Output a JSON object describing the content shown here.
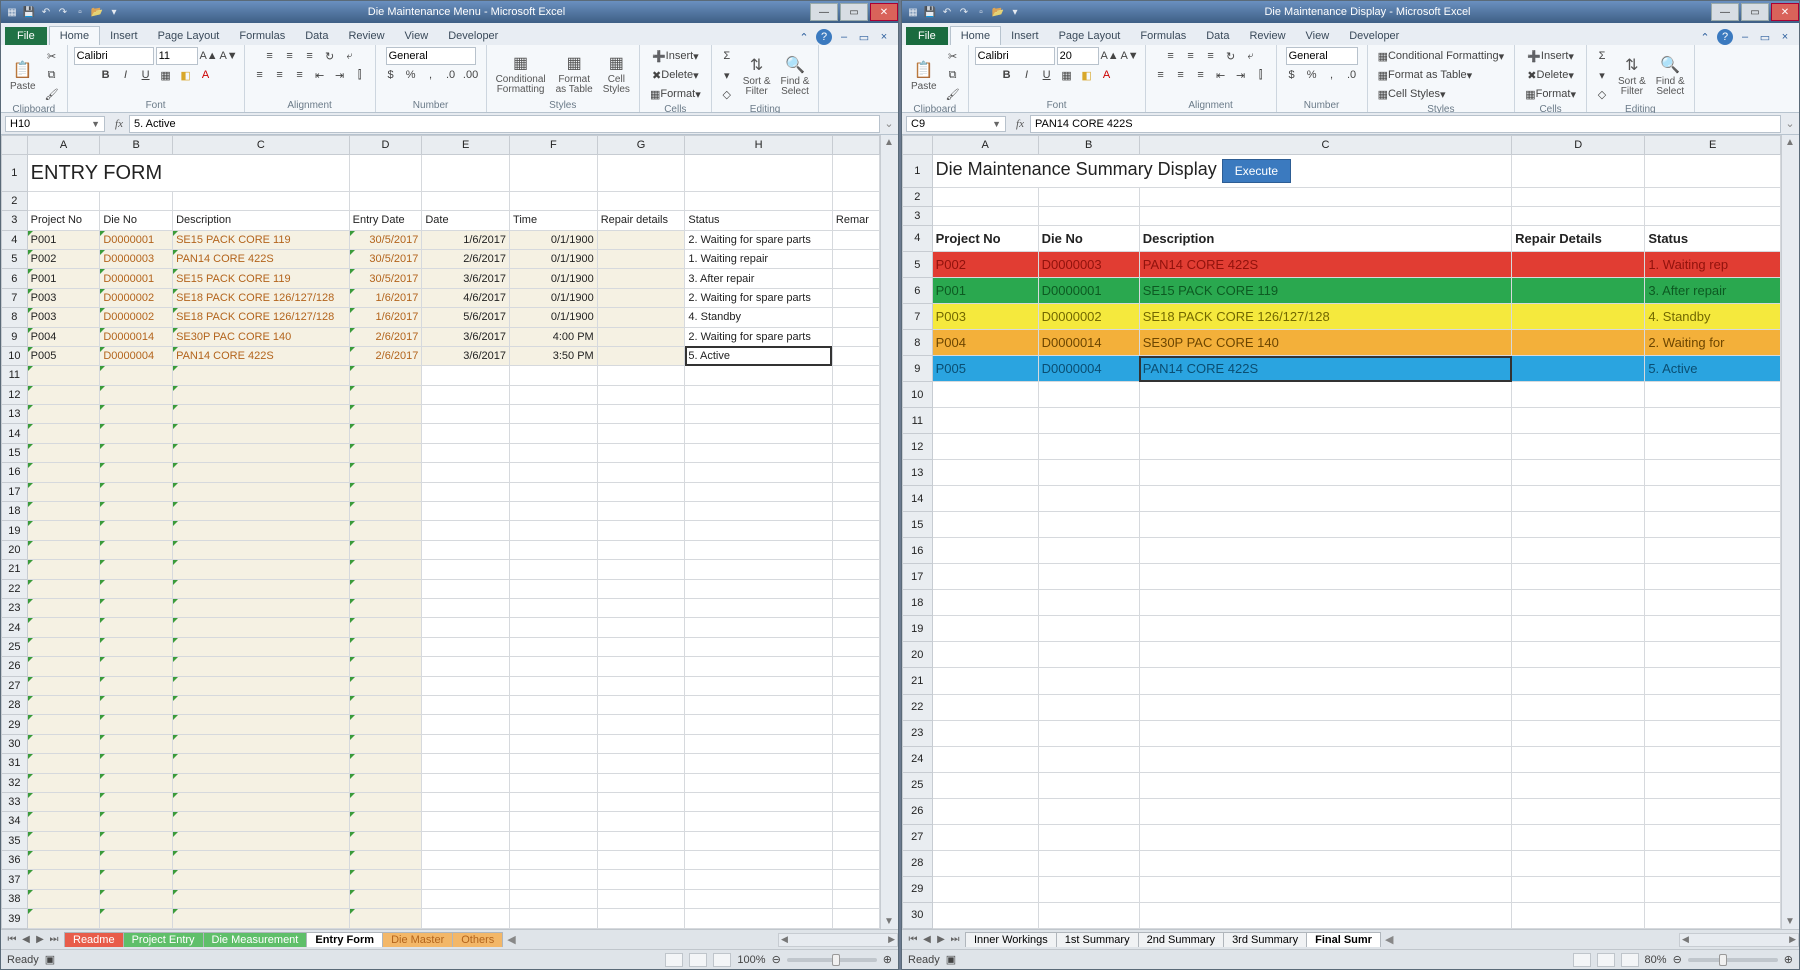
{
  "left": {
    "title": "Die Maintenance Menu - Microsoft Excel",
    "tabs": [
      "Home",
      "Insert",
      "Page Layout",
      "Formulas",
      "Data",
      "Review",
      "View",
      "Developer"
    ],
    "file": "File",
    "font": {
      "name": "Calibri",
      "size": "11"
    },
    "numfmt": "General",
    "groups": {
      "clipboard": "Clipboard",
      "font": "Font",
      "alignment": "Alignment",
      "number": "Number",
      "styles": "Styles",
      "cells": "Cells",
      "editing": "Editing"
    },
    "cmd": {
      "paste": "Paste",
      "cf": "Conditional\nFormatting",
      "fat": "Format\nas Table",
      "cs": "Cell\nStyles",
      "ins": "Insert",
      "del": "Delete",
      "fmt": "Format",
      "sort": "Sort &\nFilter",
      "find": "Find &\nSelect"
    },
    "namebox": "H10",
    "fx": "5. Active",
    "cols": [
      "A",
      "B",
      "C",
      "D",
      "E",
      "F",
      "G",
      "H"
    ],
    "heading": "ENTRY FORM",
    "hdr": [
      "Project No",
      "Die No",
      "Description",
      "Entry Date",
      "Date",
      "Time",
      "Repair details",
      "Status",
      "Remar"
    ],
    "rows": [
      {
        "p": "P001",
        "d": "D0000001",
        "desc": "SE15 PACK CORE 119",
        "ed": "30/5/2017",
        "dt": "1/6/2017",
        "tm": "0/1/1900",
        "rd": "",
        "st": "2. Waiting for spare parts"
      },
      {
        "p": "P002",
        "d": "D0000003",
        "desc": "PAN14 CORE 422S",
        "ed": "30/5/2017",
        "dt": "2/6/2017",
        "tm": "0/1/1900",
        "rd": "",
        "st": "1. Waiting repair"
      },
      {
        "p": "P001",
        "d": "D0000001",
        "desc": "SE15 PACK CORE 119",
        "ed": "30/5/2017",
        "dt": "3/6/2017",
        "tm": "0/1/1900",
        "rd": "",
        "st": "3. After repair"
      },
      {
        "p": "P003",
        "d": "D0000002",
        "desc": "SE18 PACK CORE 126/127/128",
        "ed": "1/6/2017",
        "dt": "4/6/2017",
        "tm": "0/1/1900",
        "rd": "",
        "st": "2. Waiting for spare parts"
      },
      {
        "p": "P003",
        "d": "D0000002",
        "desc": "SE18 PACK CORE 126/127/128",
        "ed": "1/6/2017",
        "dt": "5/6/2017",
        "tm": "0/1/1900",
        "rd": "",
        "st": "4. Standby"
      },
      {
        "p": "P004",
        "d": "D0000014",
        "desc": "SE30P PAC CORE 140",
        "ed": "2/6/2017",
        "dt": "3/6/2017",
        "tm": "4:00 PM",
        "rd": "",
        "st": "2. Waiting for spare parts"
      },
      {
        "p": "P005",
        "d": "D0000004",
        "desc": "PAN14 CORE 422S",
        "ed": "2/6/2017",
        "dt": "3/6/2017",
        "tm": "3:50 PM",
        "rd": "",
        "st": "5. Active"
      }
    ],
    "sheetTabs": [
      {
        "label": "Readme",
        "cls": "red"
      },
      {
        "label": "Project Entry",
        "cls": "green"
      },
      {
        "label": "Die Measurement",
        "cls": "green"
      },
      {
        "label": "Entry Form",
        "cls": "active"
      },
      {
        "label": "Die Master",
        "cls": "orange"
      },
      {
        "label": "Others",
        "cls": "orange"
      }
    ],
    "status": "Ready",
    "zoom": "100%"
  },
  "right": {
    "title": "Die Maintenance Display - Microsoft Excel",
    "tabs": [
      "Home",
      "Insert",
      "Page Layout",
      "Formulas",
      "Data",
      "Review",
      "View",
      "Developer"
    ],
    "file": "File",
    "font": {
      "name": "Calibri",
      "size": "20"
    },
    "numfmt": "General",
    "groups": {
      "clipboard": "Clipboard",
      "font": "Font",
      "alignment": "Alignment",
      "number": "Number",
      "styles": "Styles",
      "cells": "Cells",
      "editing": "Editing"
    },
    "cmd": {
      "paste": "Paste",
      "cf": "Conditional Formatting",
      "fat": "Format as Table",
      "cs": "Cell Styles",
      "ins": "Insert",
      "del": "Delete",
      "fmt": "Format",
      "sort": "Sort &\nFilter",
      "find": "Find &\nSelect"
    },
    "namebox": "C9",
    "fx": "PAN14 CORE 422S",
    "cols": [
      "A",
      "B",
      "C",
      "D"
    ],
    "heading": "Die Maintenance Summary Display",
    "execute": "Execute",
    "hdr": [
      "Project No",
      "Die No",
      "Description",
      "Repair Details",
      "Status"
    ],
    "rows": [
      {
        "p": "P002",
        "d": "D0000003",
        "desc": "PAN14 CORE 422S",
        "st": "1. Waiting rep",
        "cls": "sum-red"
      },
      {
        "p": "P001",
        "d": "D0000001",
        "desc": "SE15 PACK CORE 119",
        "st": "3. After repair",
        "cls": "sum-green"
      },
      {
        "p": "P003",
        "d": "D0000002",
        "desc": "SE18 PACK CORE 126/127/128",
        "st": "4. Standby",
        "cls": "sum-yellow"
      },
      {
        "p": "P004",
        "d": "D0000014",
        "desc": "SE30P PAC CORE 140",
        "st": "2. Waiting for",
        "cls": "sum-orange"
      },
      {
        "p": "P005",
        "d": "D0000004",
        "desc": "PAN14 CORE 422S",
        "st": "5. Active",
        "cls": "sum-blue"
      }
    ],
    "sheetTabs": [
      {
        "label": "Inner Workings",
        "cls": ""
      },
      {
        "label": "1st Summary",
        "cls": ""
      },
      {
        "label": "2nd Summary",
        "cls": ""
      },
      {
        "label": "3rd Summary",
        "cls": ""
      },
      {
        "label": "Final Sumr",
        "cls": "active"
      }
    ],
    "status": "Ready",
    "zoom": "80%"
  }
}
